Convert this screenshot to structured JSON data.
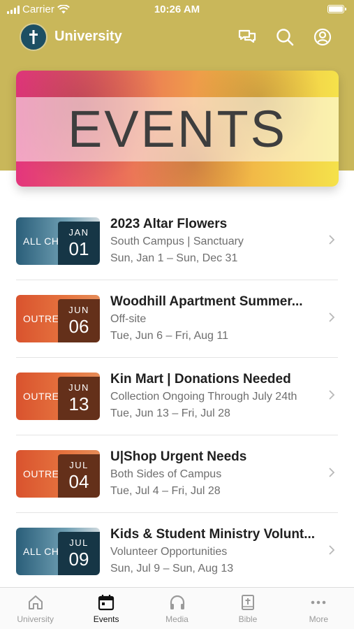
{
  "status_bar": {
    "carrier": "Carrier",
    "time": "10:26 AM"
  },
  "app_bar": {
    "title": "University"
  },
  "banner": {
    "text": "EVENTS"
  },
  "events": [
    {
      "category": "ALL CHURCH",
      "month": "JAN",
      "day": "01",
      "title": "2023 Altar Flowers",
      "location": "South Campus | Sanctuary",
      "dates": "Sun, Jan 1 – Sun, Dec 31",
      "theme": "blue"
    },
    {
      "category": "OUTREACH",
      "month": "JUN",
      "day": "06",
      "title": "Woodhill Apartment Summer...",
      "location": "Off-site",
      "dates": "Tue, Jun 6 – Fri, Aug 11",
      "theme": "orange"
    },
    {
      "category": "OUTREACH",
      "month": "JUN",
      "day": "13",
      "title": "Kin Mart | Donations Needed",
      "location": "Collection Ongoing Through July 24th",
      "dates": "Tue, Jun 13 – Fri, Jul 28",
      "theme": "orange"
    },
    {
      "category": "OUTREACH",
      "month": "JUL",
      "day": "04",
      "title": "U|Shop Urgent Needs",
      "location": "Both Sides of Campus",
      "dates": "Tue, Jul 4 – Fri, Jul 28",
      "theme": "orange"
    },
    {
      "category": "ALL CHURCH",
      "month": "JUL",
      "day": "09",
      "title": "Kids & Student Ministry Volunt...",
      "location": "Volunteer Opportunities",
      "dates": "Sun, Jul 9 – Sun, Aug 13",
      "theme": "blue"
    }
  ],
  "tab_bar": {
    "tabs": [
      {
        "label": "University",
        "icon": "home-icon"
      },
      {
        "label": "Events",
        "icon": "calendar-icon"
      },
      {
        "label": "Media",
        "icon": "headphones-icon"
      },
      {
        "label": "Bible",
        "icon": "bible-icon"
      },
      {
        "label": "More",
        "icon": "more-icon"
      }
    ],
    "active": "Events"
  },
  "colors": {
    "header": "#c9b75a",
    "blue_thumb": "#2a5e79",
    "orange_thumb": "#d9532e"
  }
}
